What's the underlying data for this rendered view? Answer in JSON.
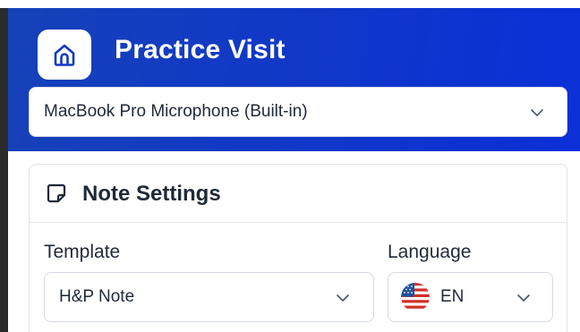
{
  "header": {
    "title": "Practice Visit",
    "home_icon": "home-icon",
    "gradient_colors": [
      "#1642b8",
      "#0c2fd8"
    ]
  },
  "microphone": {
    "selected": "MacBook Pro Microphone (Built-in)",
    "icon": "chevron-down-icon"
  },
  "note_settings": {
    "title": "Note Settings",
    "icon": "sticky-note-icon",
    "template": {
      "label": "Template",
      "selected": "H&P Note"
    },
    "language": {
      "label": "Language",
      "selected": "EN",
      "flag": "us-flag-icon"
    }
  },
  "colors": {
    "text": "#1f2937",
    "border": "#d5dae3",
    "accent": "#1238c6"
  }
}
